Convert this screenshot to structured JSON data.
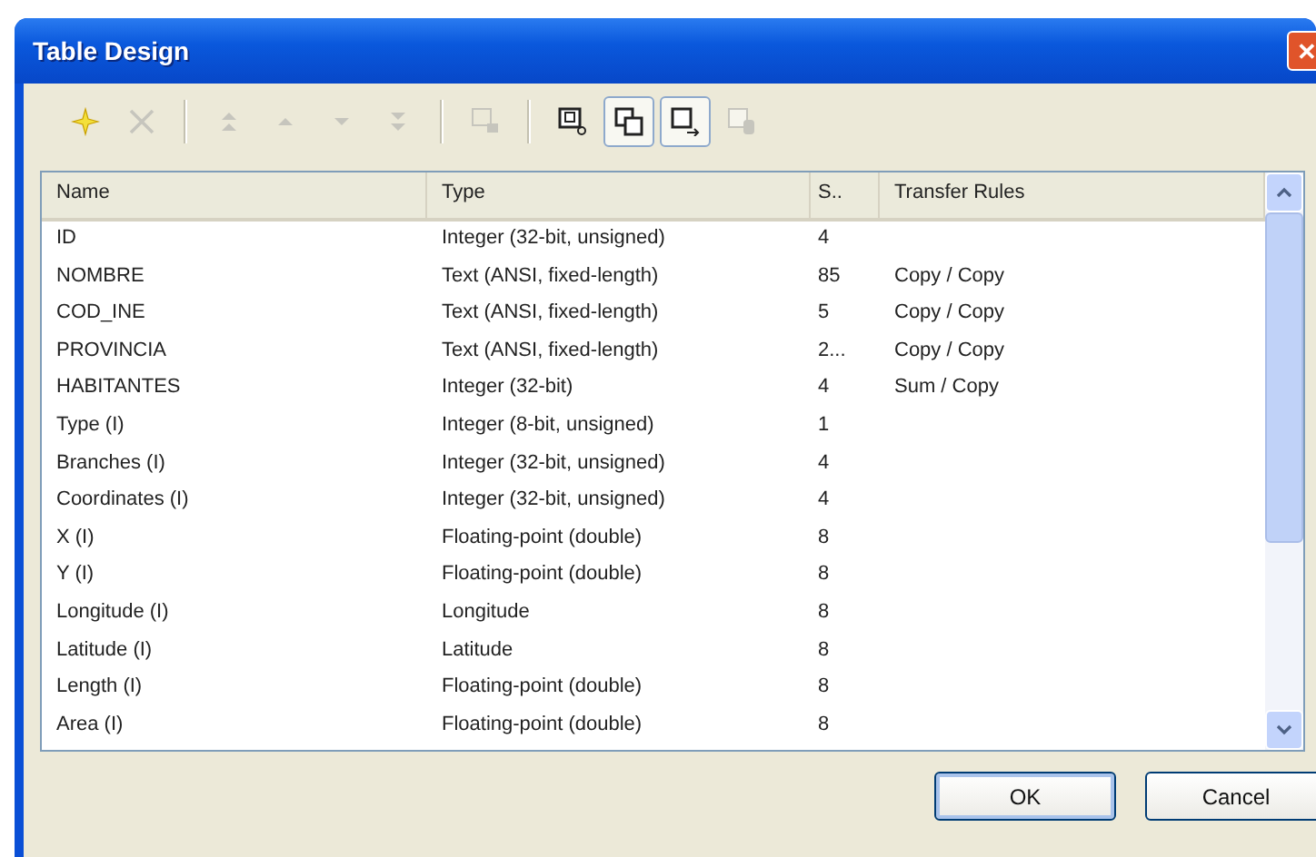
{
  "window": {
    "title": "Table Design",
    "close": "✕"
  },
  "toolbar": [
    {
      "kind": "new",
      "disabled": false,
      "pressed": false
    },
    {
      "kind": "delete",
      "disabled": true,
      "pressed": false
    },
    {
      "kind": "separator"
    },
    {
      "kind": "top",
      "disabled": true,
      "pressed": false
    },
    {
      "kind": "up",
      "disabled": true,
      "pressed": false
    },
    {
      "kind": "down",
      "disabled": true,
      "pressed": false
    },
    {
      "kind": "bottom",
      "disabled": true,
      "pressed": false
    },
    {
      "kind": "separator"
    },
    {
      "kind": "grid",
      "disabled": true,
      "pressed": false
    },
    {
      "kind": "separator"
    },
    {
      "kind": "index",
      "disabled": false,
      "pressed": false
    },
    {
      "kind": "double",
      "disabled": false,
      "pressed": true
    },
    {
      "kind": "arrows",
      "disabled": false,
      "pressed": true
    },
    {
      "kind": "cylinder",
      "disabled": true,
      "pressed": false
    }
  ],
  "table": {
    "columns": [
      "Name",
      "Type",
      "S..",
      "Transfer Rules"
    ],
    "rows": [
      [
        "ID",
        "Integer (32-bit, unsigned)",
        "4",
        ""
      ],
      [
        "NOMBRE",
        "Text (ANSI, fixed-length)",
        "85",
        "Copy / Copy"
      ],
      [
        "COD_INE",
        "Text (ANSI, fixed-length)",
        "5",
        "Copy / Copy"
      ],
      [
        "PROVINCIA",
        "Text (ANSI, fixed-length)",
        "2...",
        "Copy / Copy"
      ],
      [
        "HABITANTES",
        "Integer (32-bit)",
        "4",
        "Sum / Copy"
      ],
      [
        "Type (I)",
        "Integer (8-bit, unsigned)",
        "1",
        ""
      ],
      [
        "Branches (I)",
        "Integer (32-bit, unsigned)",
        "4",
        ""
      ],
      [
        "Coordinates (I)",
        "Integer (32-bit, unsigned)",
        "4",
        ""
      ],
      [
        "X (I)",
        "Floating-point (double)",
        "8",
        ""
      ],
      [
        "Y (I)",
        "Floating-point (double)",
        "8",
        ""
      ],
      [
        "Longitude (I)",
        "Longitude",
        "8",
        ""
      ],
      [
        "Latitude (I)",
        "Latitude",
        "8",
        ""
      ],
      [
        "Length (I)",
        "Floating-point (double)",
        "8",
        ""
      ],
      [
        "Area (I)",
        "Floating-point (double)",
        "8",
        ""
      ]
    ]
  },
  "buttons": [
    {
      "label": "OK",
      "default": true
    },
    {
      "label": "Cancel",
      "default": false
    }
  ]
}
